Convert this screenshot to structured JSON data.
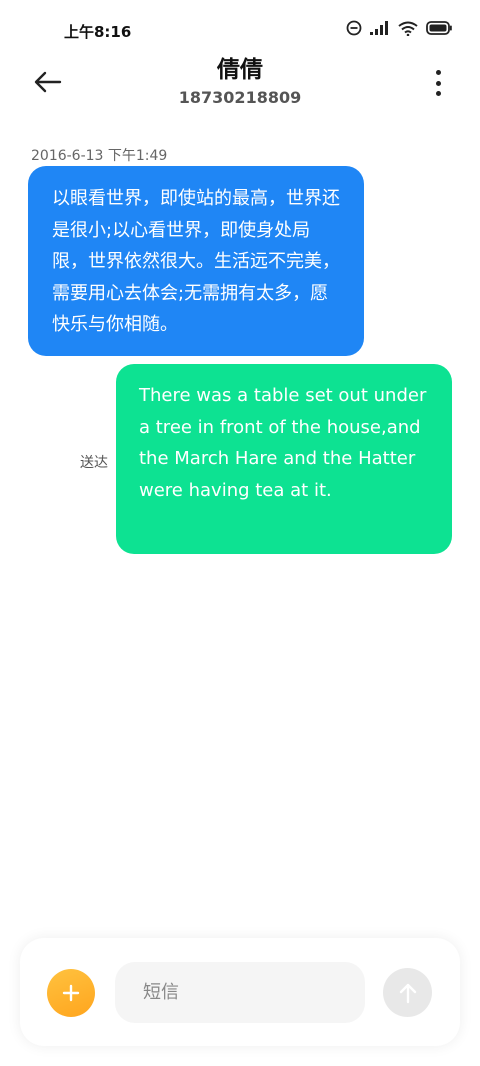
{
  "status_bar": {
    "time": "上午8:16",
    "icons": [
      "do-not-disturb-icon",
      "signal-icon",
      "wifi-icon",
      "battery-icon"
    ]
  },
  "header": {
    "back_icon": "arrow-left-icon",
    "contact_name": "倩倩",
    "contact_number": "18730218809",
    "more_icon": "more-vertical-icon"
  },
  "conversation": {
    "timestamp": "2016-6-13 下午1:49",
    "messages": [
      {
        "direction": "incoming",
        "text": "以眼看世界，即使站的最高，世界还是很小;以心看世界，即使身处局限，世界依然很大。生活远不完美，需要用心去体会;无需拥有太多，愿快乐与你相随。",
        "color": "#1f86f5"
      },
      {
        "direction": "outgoing",
        "text": "There was a table set out under a tree in front of the house,and the March Hare and the Hatter were having tea at it.",
        "color": "#0de292",
        "status": "送达"
      }
    ]
  },
  "composer": {
    "add_icon": "plus-icon",
    "input_value": "",
    "input_placeholder": "短信",
    "send_icon": "arrow-up-icon",
    "accent": "#ffb52e"
  }
}
